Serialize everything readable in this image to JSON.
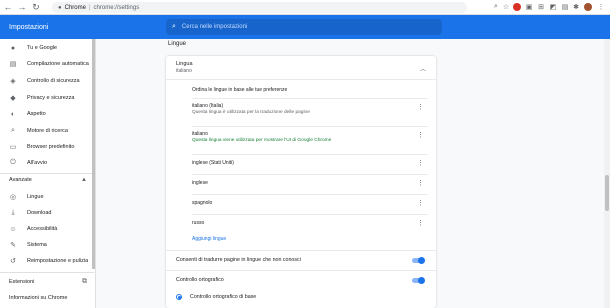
{
  "browser": {
    "tab_label": "Chrome",
    "url": "chrome://settings"
  },
  "header": {
    "title": "Impostazioni",
    "search_placeholder": "Cerca nelle impostazioni"
  },
  "sidebar": {
    "items": [
      {
        "label": "Tu e Google",
        "icon": "person-icon"
      },
      {
        "label": "Compilazione automatica",
        "icon": "clipboard-icon"
      },
      {
        "label": "Controllo di sicurezza",
        "icon": "shield-icon"
      },
      {
        "label": "Privacy e sicurezza",
        "icon": "privacy-shield-icon"
      },
      {
        "label": "Aspetto",
        "icon": "palette-icon"
      },
      {
        "label": "Motore di ricerca",
        "icon": "search-icon"
      },
      {
        "label": "Browser predefinito",
        "icon": "browser-icon"
      },
      {
        "label": "All'avvio",
        "icon": "power-icon"
      }
    ],
    "advanced_label": "Avanzate",
    "advanced_items": [
      {
        "label": "Lingue",
        "icon": "globe-icon"
      },
      {
        "label": "Download",
        "icon": "download-icon"
      },
      {
        "label": "Accessibilità",
        "icon": "accessibility-icon"
      },
      {
        "label": "Sistema",
        "icon": "wrench-icon"
      },
      {
        "label": "Reimpostazione e pulizia",
        "icon": "reset-icon"
      }
    ],
    "extensions_label": "Estensioni",
    "about_label": "Informazioni su Chrome"
  },
  "main": {
    "section_title": "Lingue",
    "language": {
      "title": "Lingua",
      "value": "italiano"
    },
    "order_label": "Ordina le lingue in base alle tue preferenze",
    "languages": [
      {
        "name": "italiano (Italia)",
        "desc": "Questa lingua è utilizzata per la traduzione delle pagine",
        "desc_green": false
      },
      {
        "name": "italiano",
        "desc": "Questa lingua viene utilizzata per mostrare l'UI di Google Chrome",
        "desc_green": true
      },
      {
        "name": "inglese (Stati Uniti)",
        "desc": "",
        "desc_green": false
      },
      {
        "name": "inglese",
        "desc": "",
        "desc_green": false
      },
      {
        "name": "spagnolo",
        "desc": "",
        "desc_green": false
      },
      {
        "name": "russo",
        "desc": "",
        "desc_green": false
      }
    ],
    "add_languages_label": "Aggiungi lingue",
    "translate_label": "Consenti di tradurre pagine in lingue che non conosci",
    "spellcheck_label": "Controllo ortografico",
    "basic_spellcheck_label": "Controllo ortografico di base"
  }
}
